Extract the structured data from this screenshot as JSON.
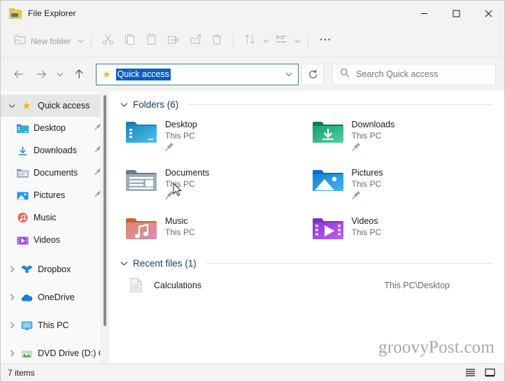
{
  "window": {
    "title": "File Explorer",
    "icon": "folder-icon",
    "controls": [
      {
        "name": "minimize",
        "glyph": "minimize-icon"
      },
      {
        "name": "maximize",
        "glyph": "maximize-icon"
      },
      {
        "name": "close",
        "glyph": "close-icon"
      }
    ]
  },
  "toolbar": {
    "new_folder_label": "New folder",
    "items": [
      {
        "name": "new-folder",
        "icon": "new-folder-icon",
        "label": "New folder",
        "has_chevron": true,
        "disabled": true
      },
      {
        "name": "cut",
        "icon": "scissors-icon",
        "disabled": true
      },
      {
        "name": "copy",
        "icon": "copy-icon",
        "disabled": true
      },
      {
        "name": "paste",
        "icon": "paste-icon",
        "disabled": true
      },
      {
        "name": "rename",
        "icon": "rename-icon",
        "disabled": true
      },
      {
        "name": "share",
        "icon": "share-icon",
        "disabled": true
      },
      {
        "name": "delete",
        "icon": "trash-icon",
        "disabled": true
      },
      {
        "name": "sort",
        "icon": "sort-icon",
        "has_chevron": true
      },
      {
        "name": "view",
        "icon": "view-icon",
        "has_chevron": true
      },
      {
        "name": "more",
        "icon": "ellipsis-icon"
      }
    ]
  },
  "navigation": {
    "back": "back-arrow-icon",
    "forward": "forward-arrow-icon",
    "recent": "chevron-down-icon",
    "up": "up-arrow-icon",
    "refresh": "refresh-icon"
  },
  "address": {
    "icon": "star-icon",
    "value": "Quick access",
    "selected": true,
    "chevron": "chevron-down-icon"
  },
  "search": {
    "icon": "search-icon",
    "placeholder": "Search Quick access"
  },
  "sidebar": {
    "items": [
      {
        "label": "Quick access",
        "icon": "star-icon",
        "expanded": true,
        "selected": true,
        "level": 0,
        "pinned": false,
        "toggle": "chevron-down"
      },
      {
        "label": "Desktop",
        "icon": "desktop-folder-icon",
        "level": 1,
        "pinned": true
      },
      {
        "label": "Downloads",
        "icon": "downloads-folder-icon",
        "level": 1,
        "pinned": true
      },
      {
        "label": "Documents",
        "icon": "documents-folder-icon",
        "level": 1,
        "pinned": true
      },
      {
        "label": "Pictures",
        "icon": "pictures-folder-icon",
        "level": 1,
        "pinned": true
      },
      {
        "label": "Music",
        "icon": "music-folder-icon",
        "level": 1,
        "pinned": false
      },
      {
        "label": "Videos",
        "icon": "videos-folder-icon",
        "level": 1,
        "pinned": false
      },
      {
        "label": "Dropbox",
        "icon": "dropbox-icon",
        "level": 0,
        "expanded": false,
        "toggle": "chevron-right"
      },
      {
        "label": "OneDrive",
        "icon": "onedrive-cloud-icon",
        "level": 0,
        "expanded": false,
        "toggle": "chevron-right"
      },
      {
        "label": "This PC",
        "icon": "this-pc-monitor-icon",
        "level": 0,
        "expanded": false,
        "toggle": "chevron-right"
      },
      {
        "label": "DVD Drive (D:) C",
        "icon": "dvd-drive-icon",
        "level": 0,
        "expanded": false,
        "toggle": "chevron-right"
      }
    ]
  },
  "content": {
    "folders_group": {
      "title": "Folders (6)",
      "expanded": true,
      "items": [
        {
          "name": "Desktop",
          "location": "This PC",
          "pinned": true,
          "icon": "desktop-folder-icon",
          "color_top": "#1c6ea4",
          "color_body": "#2f9fd0"
        },
        {
          "name": "Downloads",
          "location": "This PC",
          "pinned": true,
          "icon": "downloads-folder-icon",
          "color_top": "#0f8a5f",
          "color_body": "#2bbd8c"
        },
        {
          "name": "Documents",
          "location": "This PC",
          "pinned": true,
          "icon": "documents-folder-icon",
          "color_top": "#6e7b84",
          "color_body": "#9fb0bb"
        },
        {
          "name": "Pictures",
          "location": "This PC",
          "pinned": true,
          "icon": "pictures-folder-icon",
          "color_top": "#0d6fc4",
          "color_body": "#2196f3"
        },
        {
          "name": "Music",
          "location": "This PC",
          "pinned": false,
          "icon": "music-folder-icon",
          "color_top": "#c2672b",
          "color_body": "#e8907f"
        },
        {
          "name": "Videos",
          "location": "This PC",
          "pinned": false,
          "icon": "videos-folder-icon",
          "color_top": "#7a2fc4",
          "color_body": "#a64ce0"
        }
      ]
    },
    "recent_group": {
      "title": "Recent files (1)",
      "expanded": true,
      "items": [
        {
          "name": "Calculations",
          "location": "This PC\\Desktop",
          "icon": "document-icon"
        }
      ]
    }
  },
  "watermark": "groovyPost.com",
  "statusbar": {
    "item_count": "7 items",
    "views": [
      {
        "name": "details-view",
        "icon": "list-lines-icon"
      },
      {
        "name": "large-icons-view",
        "icon": "monitor-icon"
      }
    ]
  }
}
